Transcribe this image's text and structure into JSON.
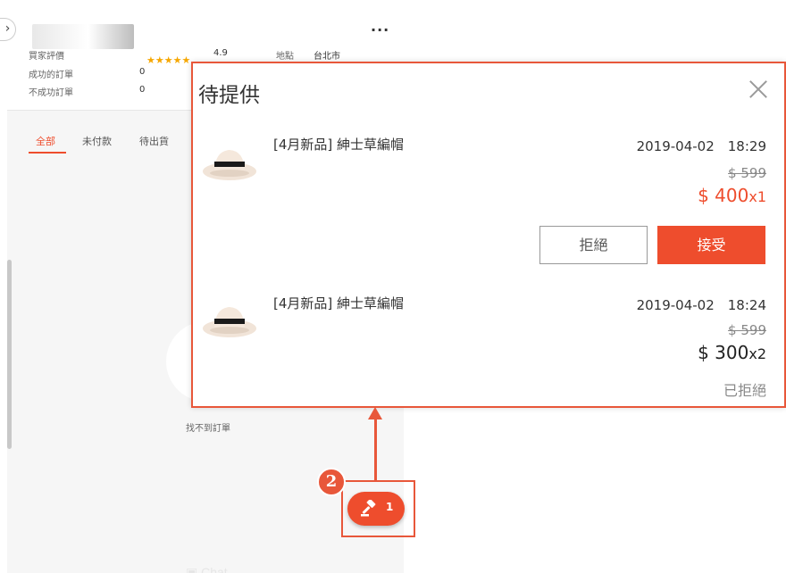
{
  "seller_panel": {
    "stats": {
      "rating_label": "買家評價",
      "rating_value": "4.9",
      "stars": "★★★★★",
      "success_label": "成功的訂單",
      "success_value": "0",
      "fail_label": "不成功訂單",
      "fail_value": "0",
      "location_label": "地點",
      "location_value": "台北市"
    },
    "more_label": "···",
    "expand_label": "›",
    "tabs": [
      "全部",
      "未付款",
      "待出貨",
      "待"
    ],
    "empty_text": "找不到訂單",
    "chat_watermark": "Chat"
  },
  "bid_button": {
    "count": "1",
    "icon": "gavel-icon"
  },
  "callout_number": "2",
  "popup": {
    "title": "待提供",
    "offers": [
      {
        "product_name": "[4月新品] 紳士草編帽",
        "datetime": "2019-04-02　18:29",
        "original_price": "$ 599",
        "offer_price": "$ 400",
        "quantity": "x1",
        "reject_label": "拒絕",
        "accept_label": "接受"
      },
      {
        "product_name": "[4月新品] 紳士草編帽",
        "datetime": "2019-04-02　18:24",
        "original_price": "$ 599",
        "offer_price": "$ 300",
        "quantity": "x2",
        "status": "已拒絕"
      }
    ]
  },
  "colors": {
    "accent": "#ee4d2d",
    "callout": "#e8573a"
  }
}
